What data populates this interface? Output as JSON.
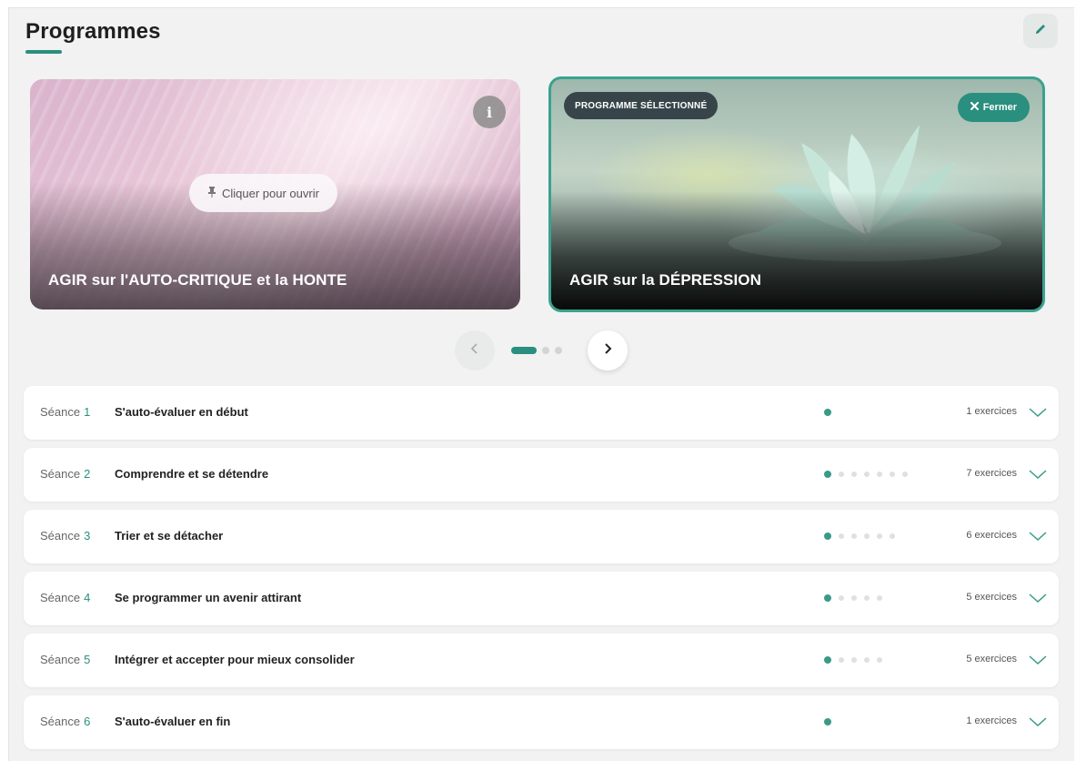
{
  "header": {
    "title": "Programmes",
    "edit_icon": "pencil-icon"
  },
  "colors": {
    "accent": "#2a8f7e",
    "badge_dark": "#37454a"
  },
  "cards": [
    {
      "title": "AGIR sur l'AUTO-CRITIQUE et la HONTE",
      "open_label": "Cliquer pour ouvrir",
      "open_icon": "pin-icon",
      "info_icon": "info-icon",
      "info_label": "i",
      "selected": false
    },
    {
      "title": "AGIR sur la DÉPRESSION",
      "badge": "PROGRAMME SÉLECTIONNÉ",
      "close_label": "Fermer",
      "close_icon": "close-icon",
      "selected": true
    }
  ],
  "carousel": {
    "prev_icon": "chevron-left-icon",
    "next_icon": "chevron-right-icon",
    "page_count": 3,
    "active_page": 1
  },
  "sessions": [
    {
      "prefix": "Séance",
      "number": "1",
      "title": "S'auto-évaluer en début",
      "exercise_count": 1,
      "count_label": "1 exercices",
      "completed": 1
    },
    {
      "prefix": "Séance",
      "number": "2",
      "title": "Comprendre et se détendre",
      "exercise_count": 7,
      "count_label": "7 exercices",
      "completed": 1
    },
    {
      "prefix": "Séance",
      "number": "3",
      "title": "Trier et se détacher",
      "exercise_count": 6,
      "count_label": "6 exercices",
      "completed": 1
    },
    {
      "prefix": "Séance",
      "number": "4",
      "title": "Se programmer un avenir attirant",
      "exercise_count": 5,
      "count_label": "5 exercices",
      "completed": 1
    },
    {
      "prefix": "Séance",
      "number": "5",
      "title": "Intégrer et accepter pour mieux consolider",
      "exercise_count": 5,
      "count_label": "5 exercices",
      "completed": 1
    },
    {
      "prefix": "Séance",
      "number": "6",
      "title": "S'auto-évaluer en fin",
      "exercise_count": 1,
      "count_label": "1 exercices",
      "completed": 1
    }
  ]
}
